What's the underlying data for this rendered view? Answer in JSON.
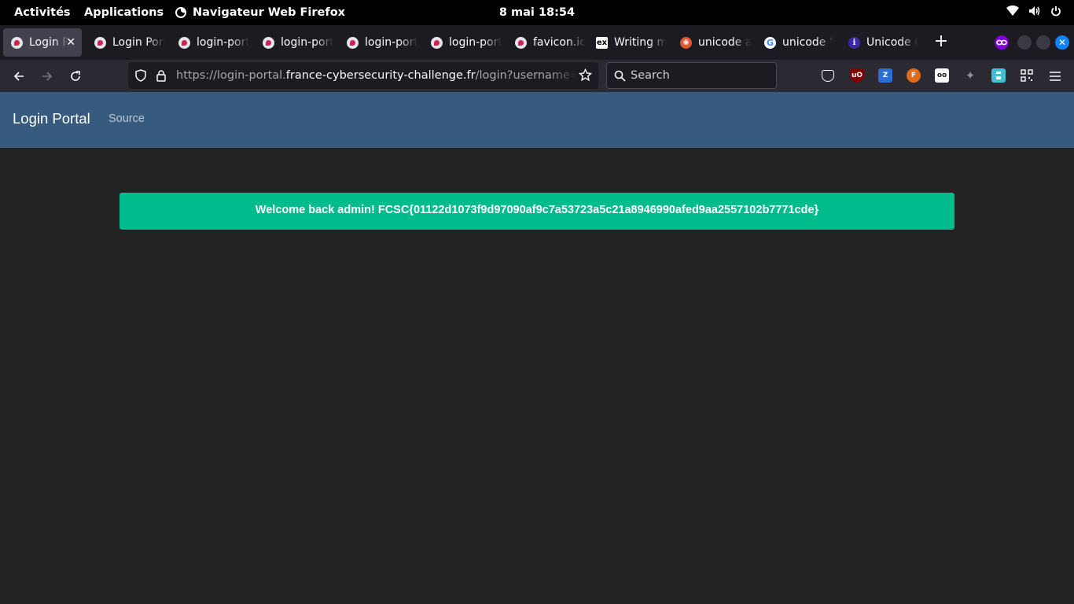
{
  "system_bar": {
    "activities": "Activités",
    "applications": "Applications",
    "app_name": "Navigateur Web Firefox",
    "clock": "8 mai  18:54",
    "icons": [
      "wifi-icon",
      "volume-icon",
      "power-icon"
    ]
  },
  "tabs": [
    {
      "label": "Login Portal",
      "favicon": "fcsc",
      "active": true
    },
    {
      "label": "Login Portal",
      "favicon": "fcsc"
    },
    {
      "label": "login-portal",
      "favicon": "fcsc"
    },
    {
      "label": "login-portal",
      "favicon": "fcsc"
    },
    {
      "label": "login-portal",
      "favicon": "fcsc"
    },
    {
      "label": "login-portal",
      "favicon": "fcsc"
    },
    {
      "label": "favicon.ico",
      "favicon": "fcsc"
    },
    {
      "label": "Writing m",
      "favicon": "ex",
      "favicon_text": "ex"
    },
    {
      "label": "unicode a",
      "favicon": "ddg"
    },
    {
      "label": "unicode \"i",
      "favicon": "g",
      "favicon_text": "G"
    },
    {
      "label": "Unicode C",
      "favicon": "i",
      "favicon_text": "i"
    }
  ],
  "toolbar": {
    "url_prefix": "https://login-portal.",
    "url_host": "france-cybersecurity-challenge.fr",
    "url_rest": "/login?username=admin",
    "search_placeholder": "Search",
    "extensions": [
      {
        "name": "pocket-icon",
        "color": "#2b2a33"
      },
      {
        "name": "ublock-icon",
        "color": "#800000",
        "text": "uO"
      },
      {
        "name": "zotero-icon",
        "color": "#2b6fd6",
        "text": "Z"
      },
      {
        "name": "foxyproxy-icon",
        "color": "#e06c1a",
        "text": "F"
      },
      {
        "name": "wappalyzer-icon",
        "color": "#fbfbfe",
        "text": "oo"
      },
      {
        "name": "puzzle-icon",
        "color": "#6b6a73"
      },
      {
        "name": "save-icon",
        "color": "#3ec1d3"
      },
      {
        "name": "qr-icon",
        "color": "#fbfbfe"
      }
    ]
  },
  "site": {
    "brand": "Login Portal",
    "nav_link": "Source",
    "alert_message": "Welcome back admin! FCSC{01122d1073f9d97090af9c7a53723a5c21a8946990afed9aa2557102b7771cde}",
    "colors": {
      "navbar": "#375a7f",
      "alert": "#00bc8c",
      "background": "#222222"
    }
  }
}
